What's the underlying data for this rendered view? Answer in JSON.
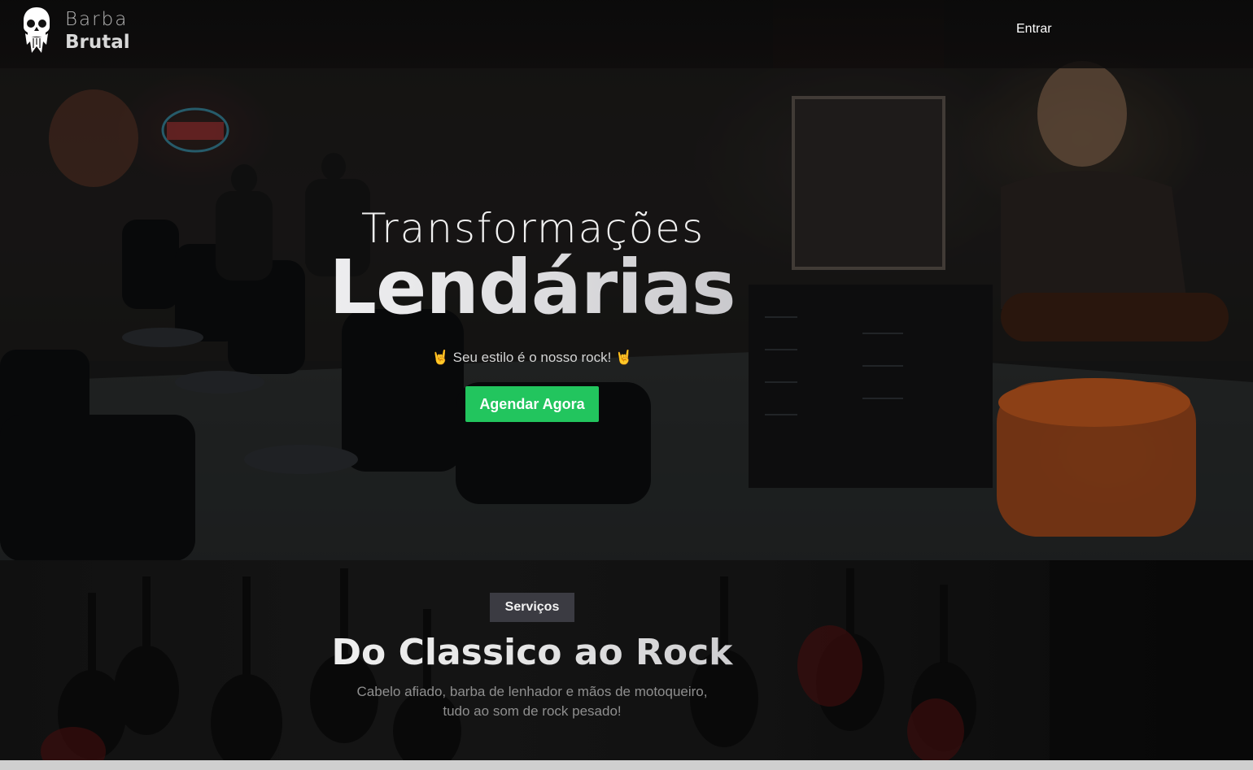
{
  "header": {
    "brand_top": "Barba",
    "brand_bottom": "Brutal",
    "logo_icon": "bearded-skull-icon",
    "nav_login": "Entrar"
  },
  "hero": {
    "line1": "Transformações",
    "line2": "Lendárias",
    "tagline_emoji_left": "🤘",
    "tagline": "Seu estilo é o nosso rock!",
    "tagline_emoji_right": "🤘",
    "cta_label": "Agendar Agora",
    "cta_color": "#22c55e"
  },
  "services": {
    "badge": "Serviços",
    "title": "Do Classico ao Rock",
    "subtitle_line1": "Cabelo afiado, barba de lenhador e mãos de motoqueiro,",
    "subtitle_line2": "tudo ao som de rock pesado!"
  }
}
